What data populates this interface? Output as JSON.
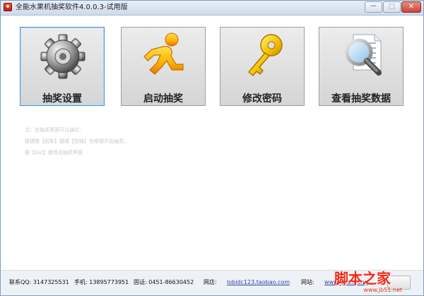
{
  "window": {
    "title": "全能水果机抽奖软件4.0.0.3-试用版",
    "controls": {
      "minimize": "－",
      "maximize": "□",
      "close": "✕"
    }
  },
  "menu_tiles": [
    {
      "label": "抽奖设置",
      "icon": "gear-icon",
      "selected": true
    },
    {
      "label": "启动抽奖",
      "icon": "runner-icon",
      "selected": false
    },
    {
      "label": "修改密码",
      "icon": "key-icon",
      "selected": false
    },
    {
      "label": "查看抽奖数据",
      "icon": "search-document-icon",
      "selected": false
    }
  ],
  "notes": [
    "注：在抽奖界面可以通过：",
    "按键盘【回车】键或【空格】空格键开启抽奖。",
    "按【Esc】键退出抽奖界面"
  ],
  "footer": {
    "qq": "联系QQ: 3147325531",
    "mobile": "手机: 13895773951",
    "phone": "固话: 0451-86630452",
    "shop_label": "网店:",
    "shop_link": "lobidc123.taobao.com",
    "site_label": "网站:",
    "site_link": "www.quanneng",
    "watermark": "脚本之家",
    "watermark_url": "www.jb51.net"
  },
  "colors": {
    "selected_border": "#4b92d0",
    "tile_background": "#dedede",
    "watermark": "#f32a18"
  }
}
